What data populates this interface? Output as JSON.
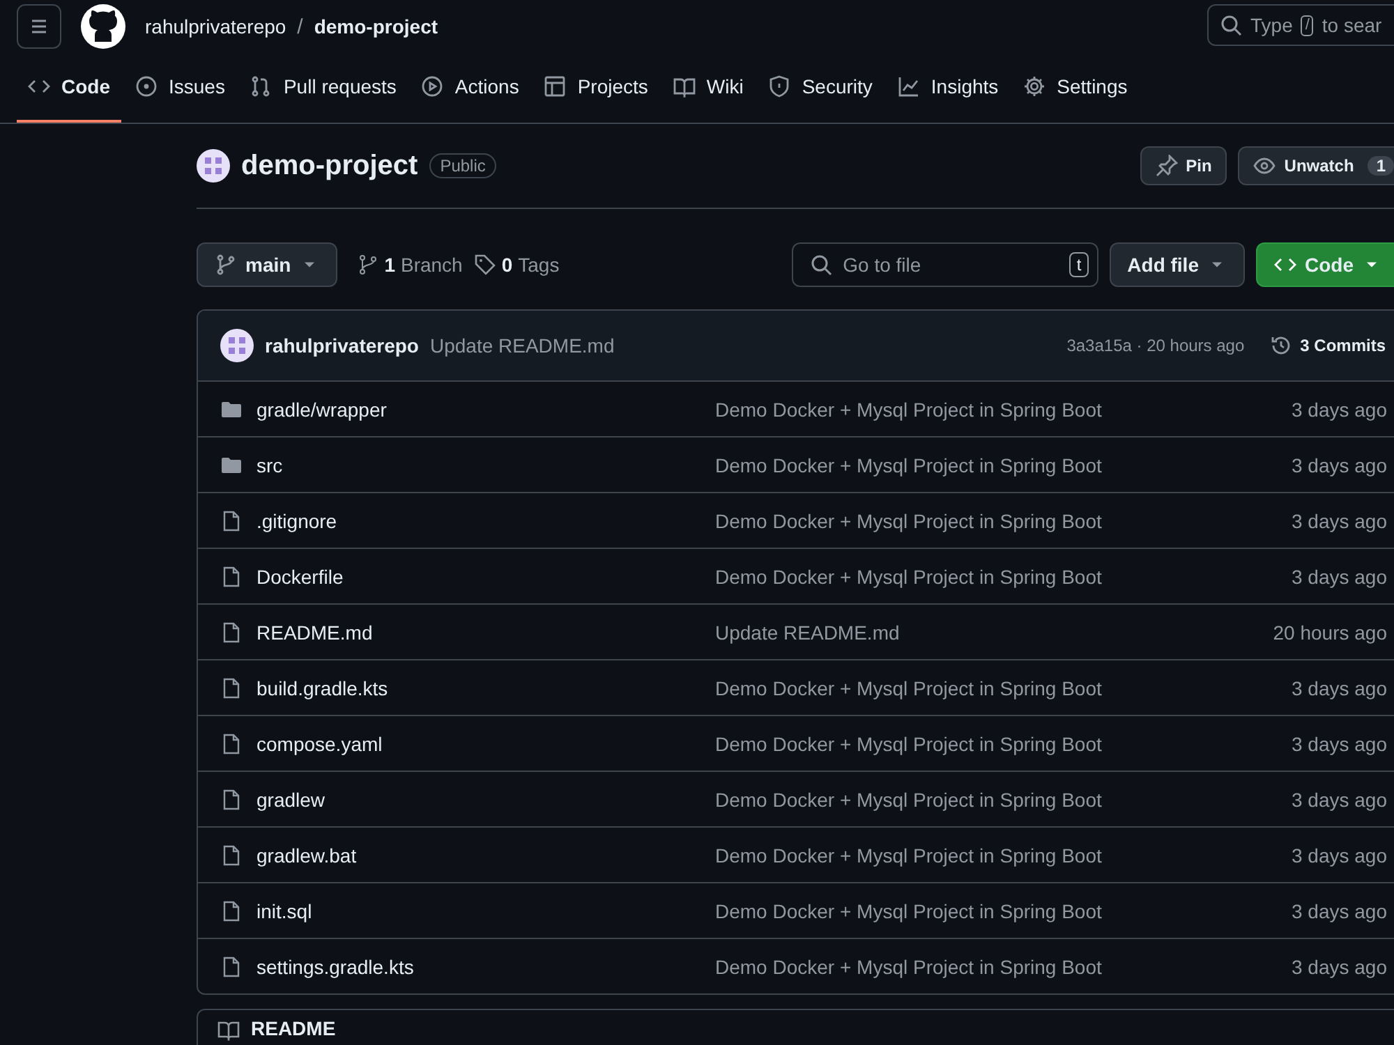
{
  "header": {
    "owner": "rahulprivaterepo",
    "separator": "/",
    "repo": "demo-project",
    "search": {
      "prefix": "Type",
      "key": "/",
      "suffix": "to sear"
    }
  },
  "tabs": [
    {
      "label": "Code",
      "selected": true
    },
    {
      "label": "Issues",
      "selected": false
    },
    {
      "label": "Pull requests",
      "selected": false
    },
    {
      "label": "Actions",
      "selected": false
    },
    {
      "label": "Projects",
      "selected": false
    },
    {
      "label": "Wiki",
      "selected": false
    },
    {
      "label": "Security",
      "selected": false
    },
    {
      "label": "Insights",
      "selected": false
    },
    {
      "label": "Settings",
      "selected": false
    }
  ],
  "repo": {
    "name": "demo-project",
    "visibility": "Public",
    "pin": "Pin",
    "unwatch": "Unwatch",
    "watch_count": "1"
  },
  "toolbar": {
    "branch": "main",
    "branches_count": "1",
    "branches_label": "Branch",
    "tags_count": "0",
    "tags_label": "Tags",
    "go_to_file": "Go to file",
    "shortcut": "t",
    "add_file": "Add file",
    "code": "Code"
  },
  "latest_commit": {
    "author": "rahulprivaterepo",
    "message": "Update README.md",
    "sha": "3a3a15a",
    "separator": "·",
    "time": "20 hours ago",
    "commits": "3 Commits"
  },
  "files": [
    {
      "kind": "folder",
      "name": "gradle/wrapper",
      "message": "Demo Docker + Mysql Project in Spring Boot",
      "time": "3 days ago"
    },
    {
      "kind": "folder",
      "name": "src",
      "message": "Demo Docker + Mysql Project in Spring Boot",
      "time": "3 days ago"
    },
    {
      "kind": "file",
      "name": ".gitignore",
      "message": "Demo Docker + Mysql Project in Spring Boot",
      "time": "3 days ago"
    },
    {
      "kind": "file",
      "name": "Dockerfile",
      "message": "Demo Docker + Mysql Project in Spring Boot",
      "time": "3 days ago"
    },
    {
      "kind": "file",
      "name": "README.md",
      "message": "Update README.md",
      "time": "20 hours ago"
    },
    {
      "kind": "file",
      "name": "build.gradle.kts",
      "message": "Demo Docker + Mysql Project in Spring Boot",
      "time": "3 days ago"
    },
    {
      "kind": "file",
      "name": "compose.yaml",
      "message": "Demo Docker + Mysql Project in Spring Boot",
      "time": "3 days ago"
    },
    {
      "kind": "file",
      "name": "gradlew",
      "message": "Demo Docker + Mysql Project in Spring Boot",
      "time": "3 days ago"
    },
    {
      "kind": "file",
      "name": "gradlew.bat",
      "message": "Demo Docker + Mysql Project in Spring Boot",
      "time": "3 days ago"
    },
    {
      "kind": "file",
      "name": "init.sql",
      "message": "Demo Docker + Mysql Project in Spring Boot",
      "time": "3 days ago"
    },
    {
      "kind": "file",
      "name": "settings.gradle.kts",
      "message": "Demo Docker + Mysql Project in Spring Boot",
      "time": "3 days ago"
    }
  ],
  "readme": {
    "title": "README"
  }
}
